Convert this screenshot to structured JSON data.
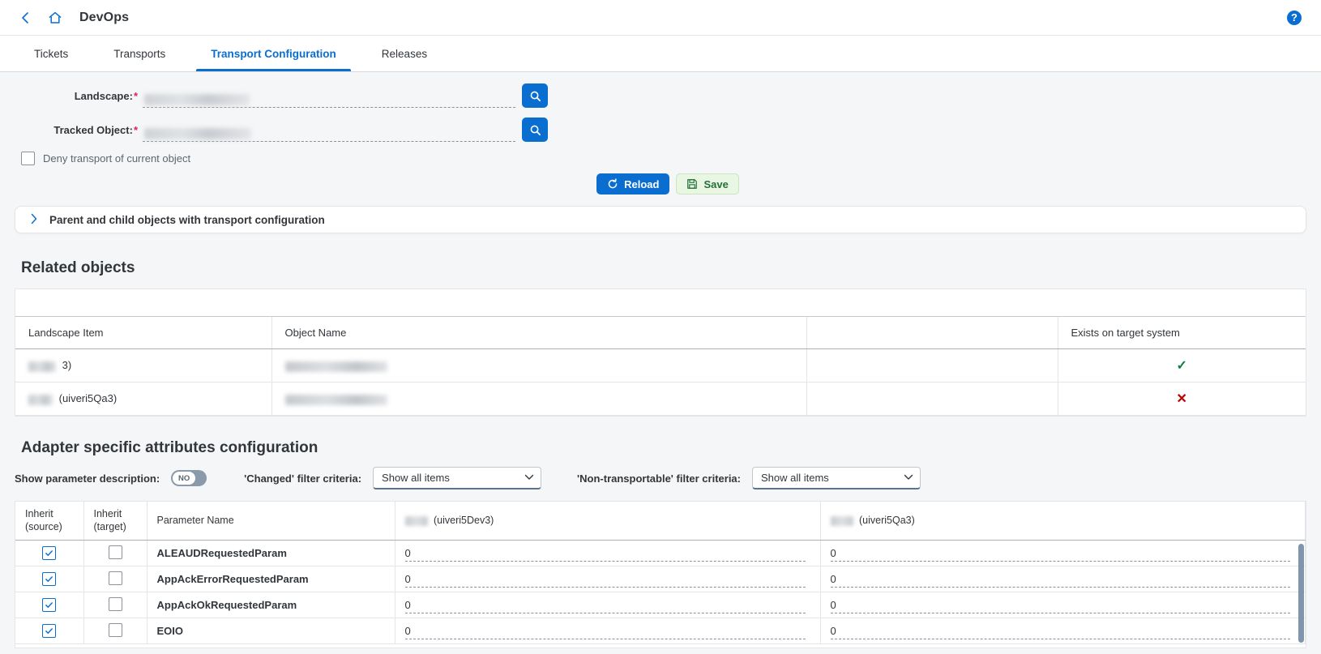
{
  "shellbar": {
    "back_label": "‹",
    "home_icon": "home-icon",
    "title": "DevOps",
    "help_label": "?"
  },
  "tabs": [
    {
      "label": "Tickets",
      "selected": false
    },
    {
      "label": "Transports",
      "selected": false
    },
    {
      "label": "Transport Configuration",
      "selected": true
    },
    {
      "label": "Releases",
      "selected": false
    }
  ],
  "form": {
    "landscape": {
      "label": "Landscape:",
      "required": "*",
      "value": "",
      "redacted": true
    },
    "tracked_object": {
      "label": "Tracked Object:",
      "required": "*",
      "value": "",
      "redacted": true
    },
    "deny_checkbox": {
      "label": "Deny transport of current object",
      "checked": false
    },
    "reload_button": "Reload",
    "save_button": "Save"
  },
  "panel": {
    "title": "Parent and child objects with transport configuration",
    "expanded": false
  },
  "related_objects": {
    "title": "Related objects",
    "columns": [
      "Landscape Item",
      "Object Name",
      "",
      "Exists on target system"
    ],
    "rows": [
      {
        "landscape_item": "3)",
        "object_name": "",
        "blank": "",
        "exists": "✓",
        "exists_state": "yes"
      },
      {
        "landscape_item": "(uiveri5Qa3)",
        "object_name": "",
        "blank": "",
        "exists": "✕",
        "exists_state": "no"
      }
    ]
  },
  "adapter_section": {
    "title": "Adapter specific attributes configuration",
    "show_param_description_label": "Show parameter description:",
    "show_param_description_value": "NO",
    "changed_filter_label": "'Changed' filter criteria:",
    "changed_filter_value": "Show all items",
    "nontransportable_filter_label": "'Non-transportable' filter criteria:",
    "nontransportable_filter_value": "Show all items"
  },
  "params_table": {
    "columns": {
      "inherit_source": "Inherit (source)",
      "inherit_source_l1": "Inherit",
      "inherit_source_l2": "(source)",
      "inherit_target_l1": "Inherit",
      "inherit_target_l2": "(target)",
      "parameter_name": "Parameter Name",
      "system_dev": "(uiveri5Dev3)",
      "system_qa": "(uiveri5Qa3)"
    },
    "rows": [
      {
        "inherit_source": true,
        "inherit_target": false,
        "name": "ALEAUDRequestedParam",
        "dev_value": "0",
        "qa_value": "0"
      },
      {
        "inherit_source": true,
        "inherit_target": false,
        "name": "AppAckErrorRequestedParam",
        "dev_value": "0",
        "qa_value": "0"
      },
      {
        "inherit_source": true,
        "inherit_target": false,
        "name": "AppAckOkRequestedParam",
        "dev_value": "0",
        "qa_value": "0"
      },
      {
        "inherit_source": true,
        "inherit_target": false,
        "name": "EOIO",
        "dev_value": "0",
        "qa_value": "0"
      }
    ]
  },
  "colors": {
    "accent": "#0a6ed1",
    "success": "#107e3e",
    "error": "#bb0000",
    "required": "#e01e5a",
    "page_bg": "#f5f6f7"
  }
}
